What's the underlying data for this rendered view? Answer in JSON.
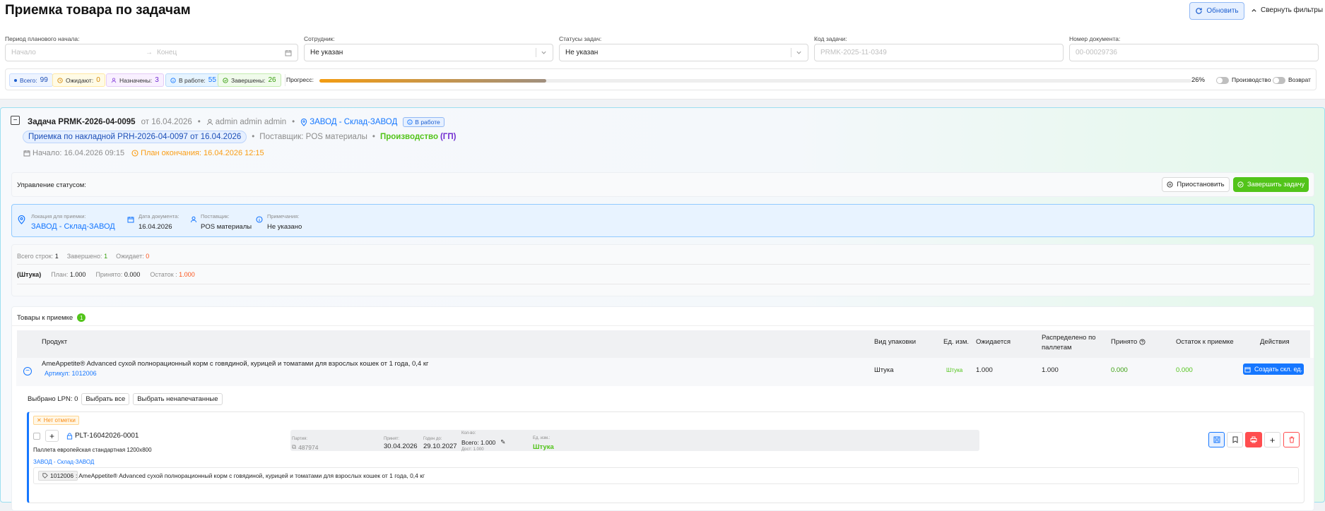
{
  "header": {
    "title": "Приемка товара по задачам",
    "refresh_label": "Обновить",
    "collapse_label": "Свернуть фильтры"
  },
  "filters": {
    "period_label": "Период планового начала:",
    "period_start_placeholder": "Начало",
    "period_end_placeholder": "Конец",
    "employee_label": "Сотрудник:",
    "employee_value": "Не указан",
    "status_label": "Статусы задач:",
    "status_value": "Не указан",
    "task_code_label": "Код задачи:",
    "task_code_placeholder": "PRMK-2025-11-0349",
    "doc_number_label": "Номер документа:",
    "doc_number_placeholder": "00-00029736"
  },
  "stats": {
    "total_label": "Всего:",
    "total_value": "99",
    "waiting_label": "Ожидают:",
    "waiting_value": "0",
    "assigned_label": "Назначены:",
    "assigned_value": "3",
    "in_work_label": "В работе:",
    "in_work_value": "55",
    "done_label": "Завершены:",
    "done_value": "26",
    "progress_label": "Прогресс:",
    "progress_percent": 26,
    "progress_text": "26%",
    "production_label": "Производство",
    "return_label": "Возврат"
  },
  "task": {
    "title": "Задача PRMK-2026-04-0095",
    "date": "от 16.04.2026",
    "user": "admin admin admin",
    "location": "ЗАВОД - Склад-ЗАВОД",
    "status_badge": "В работе",
    "invoice": "Приемка по накладной PRH-2026-04-0097 от 16.04.2026",
    "supplier": "Поставщик: POS материалы",
    "production": "Производство",
    "production_suffix": "(ГП)",
    "start": "Начало: 16.04.2026 09:15",
    "plan_end": "План окончания: 16.04.2026 12:15",
    "status_mgmt_label": "Управление статусом:",
    "pause_label": "Приостановить",
    "finish_label": "Завершить задачу"
  },
  "info": {
    "location_label": "Локация для приемки:",
    "location_value": "ЗАВОД - Склад-ЗАВОД",
    "doc_date_label": "Дата документа:",
    "doc_date_value": "16.04.2026",
    "supplier_label": "Поставщик:",
    "supplier_value": "POS материалы",
    "notes_label": "Примечания:",
    "notes_value": "Не указано"
  },
  "summary": {
    "rows_label": "Всего строк:",
    "rows_value": "1",
    "done_label": "Завершено:",
    "done_value": "1",
    "waiting_label": "Ожидает:",
    "waiting_value": "0",
    "unit": "(Штука)",
    "plan_label": "План:",
    "plan_value": "1.000",
    "accepted_label": "Принято:",
    "accepted_value": "0.000",
    "rest_label": "Остаток :",
    "rest_value": "1.000"
  },
  "goods": {
    "title": "Товары к приемке",
    "count": "1",
    "columns": [
      "Продукт",
      "Вид упаковки",
      "Ед. изм.",
      "Ожидается",
      "Распределено по паллетам",
      "Принято",
      "Остаток к приемке",
      "Действия"
    ],
    "product_name": "AmeAppetite® Advanced сухой полнорационный корм с говядиной, курицей и томатами для взрослых кошек от 1 года, 0,4 кг",
    "article": "Артикул: 1012006",
    "pack": "Штука",
    "unit": "Штука",
    "expected": "1.000",
    "distributed": "1.000",
    "accepted": "0.000",
    "rest": "0.000",
    "create_btn": "Создать скл. ед."
  },
  "lpn": {
    "selected_label": "Выбрано LPN: 0",
    "select_all": "Выбрать все",
    "select_unprinted": "Выбрать ненапечатанные",
    "no_mark": "Нет отметки",
    "code": "PLT-16042026-0001",
    "pallet": "Паллета европейская стандартная 1200x800",
    "location": "ЗАВОД - Склад-ЗАВОД",
    "batch_label": "Партия:",
    "batch_value": "487974",
    "received_label": "Принят:",
    "received_value": "30.04.2026",
    "valid_label": "Годен до:",
    "valid_value": "29.10.2027",
    "qty_label": "Кол-во:",
    "qty_total": "Всего: 1.000",
    "qty_avail": "Дост: 1.000",
    "unit_label": "Ед. изм.:",
    "unit_value": "Штука",
    "article": "1012006",
    "product": "AmeAppetite® Advanced сухой полнорационный корм с говядиной, курицей и томатами для взрослых кошек от 1 года, 0,4 кг"
  }
}
